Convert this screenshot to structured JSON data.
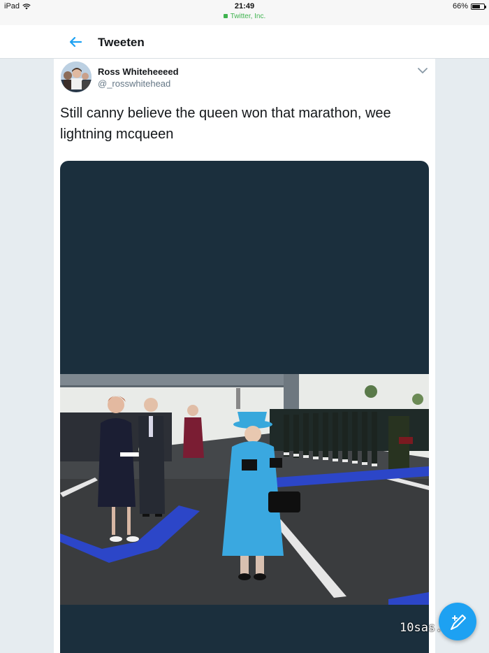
{
  "status_bar": {
    "device": "iPad",
    "time": "21:49",
    "site": "Twitter, Inc.",
    "battery": "66%",
    "battery_level": 0.66
  },
  "header": {
    "title": "Tweeten"
  },
  "tweet": {
    "display_name": "Ross Whiteheeeed",
    "handle": "@_rosswhitehead",
    "text": "Still canny believe the queen won that marathon, wee lightning mcqueen"
  },
  "watermark": "10sas.lol",
  "icons": {
    "back": "arrow-left-icon",
    "menu": "chevron-down-icon",
    "compose": "compose-tweet-icon",
    "wifi": "wifi-icon",
    "lock": "lock-icon",
    "battery": "battery-icon"
  },
  "colors": {
    "accent": "#1da1f2",
    "background": "#e6ecf0",
    "media_background": "#1b2f3d",
    "site_green": "#3fb34f"
  }
}
